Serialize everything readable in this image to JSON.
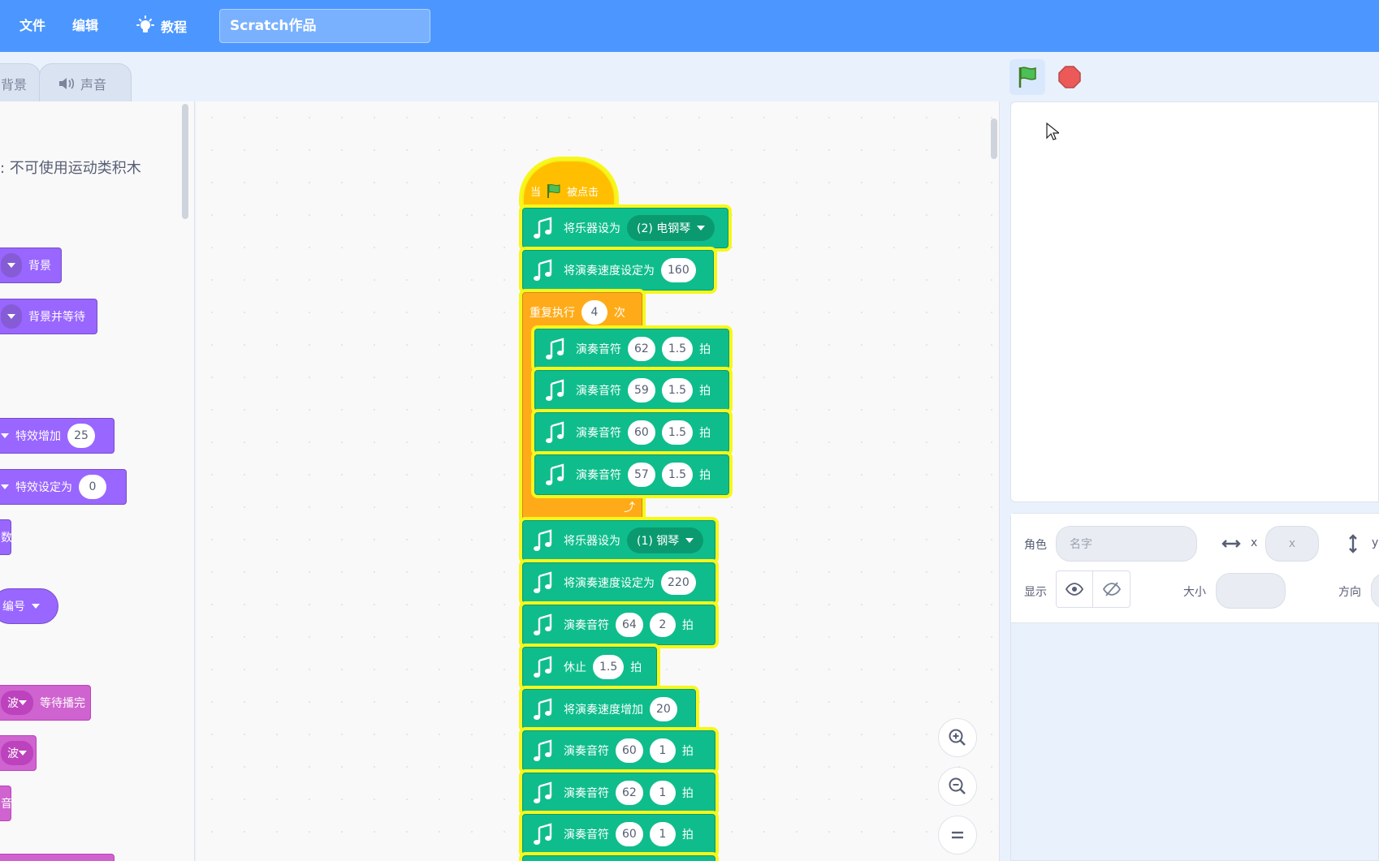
{
  "menu": {
    "file": "文件",
    "edit": "编辑",
    "tutorials": "教程",
    "project_title": "Scratch作品"
  },
  "tabs": {
    "backdrops": "背景",
    "sounds": "声音"
  },
  "palette": {
    "label": ": 不可使用运动类积木",
    "blocks": {
      "switch_backdrop": "背景",
      "switch_backdrop_wait": "背景并等待",
      "change_effect": "特效增加",
      "change_effect_value": "25",
      "set_effect": "特效设定为",
      "set_effect_value": "0",
      "fragment_shu": "数",
      "number_dropdown": "编号",
      "play_sound_frag": "波",
      "play_until_done": "等待播完",
      "start_sound_frag": "波",
      "stop_sounds_frag": "音"
    }
  },
  "script": {
    "hat": {
      "when": "当",
      "clicked": "被点击"
    },
    "set_instrument_1": {
      "label": "将乐器设为",
      "value": "(2) 电钢琴"
    },
    "set_tempo_1": {
      "label": "将演奏速度设定为",
      "value": "160"
    },
    "repeat": {
      "label": "重复执行",
      "times": "4",
      "suffix": "次"
    },
    "inner_notes": [
      {
        "label": "演奏音符",
        "note": "62",
        "beats": "1.5",
        "unit": "拍"
      },
      {
        "label": "演奏音符",
        "note": "59",
        "beats": "1.5",
        "unit": "拍"
      },
      {
        "label": "演奏音符",
        "note": "60",
        "beats": "1.5",
        "unit": "拍"
      },
      {
        "label": "演奏音符",
        "note": "57",
        "beats": "1.5",
        "unit": "拍"
      }
    ],
    "set_instrument_2": {
      "label": "将乐器设为",
      "value": "(1) 钢琴"
    },
    "set_tempo_2": {
      "label": "将演奏速度设定为",
      "value": "220"
    },
    "note_after": {
      "label": "演奏音符",
      "note": "64",
      "beats": "2",
      "unit": "拍"
    },
    "rest": {
      "label": "休止",
      "beats": "1.5",
      "unit": "拍"
    },
    "change_tempo": {
      "label": "将演奏速度增加",
      "value": "20"
    },
    "tail_notes": [
      {
        "label": "演奏音符",
        "note": "60",
        "beats": "1",
        "unit": "拍"
      },
      {
        "label": "演奏音符",
        "note": "62",
        "beats": "1",
        "unit": "拍"
      },
      {
        "label": "演奏音符",
        "note": "60",
        "beats": "1",
        "unit": "拍"
      }
    ]
  },
  "sprite_info": {
    "sprite_label": "角色",
    "name_placeholder": "名字",
    "x_label": "x",
    "x_placeholder": "x",
    "y_label": "y",
    "show_label": "显示",
    "size_label": "大小",
    "direction_label": "方向"
  },
  "colors": {
    "menu_blue": "#4c97ff",
    "music_green": "#0fbd8c",
    "control_orange": "#ffab19",
    "events_yellow": "#ffbf00",
    "glow": "#f7f71b",
    "looks_purple": "#9966ff",
    "sound_pink": "#cf63cf",
    "stop_red": "#ec5959"
  },
  "icons": [
    "lightbulb-icon",
    "speaker-icon",
    "green-flag-icon",
    "stop-icon",
    "music-icon",
    "zoom-in-icon",
    "zoom-out-icon",
    "zoom-reset-icon",
    "eye-icon",
    "eye-off-icon",
    "arrows-horizontal-icon",
    "arrows-vertical-icon",
    "cursor-icon"
  ]
}
